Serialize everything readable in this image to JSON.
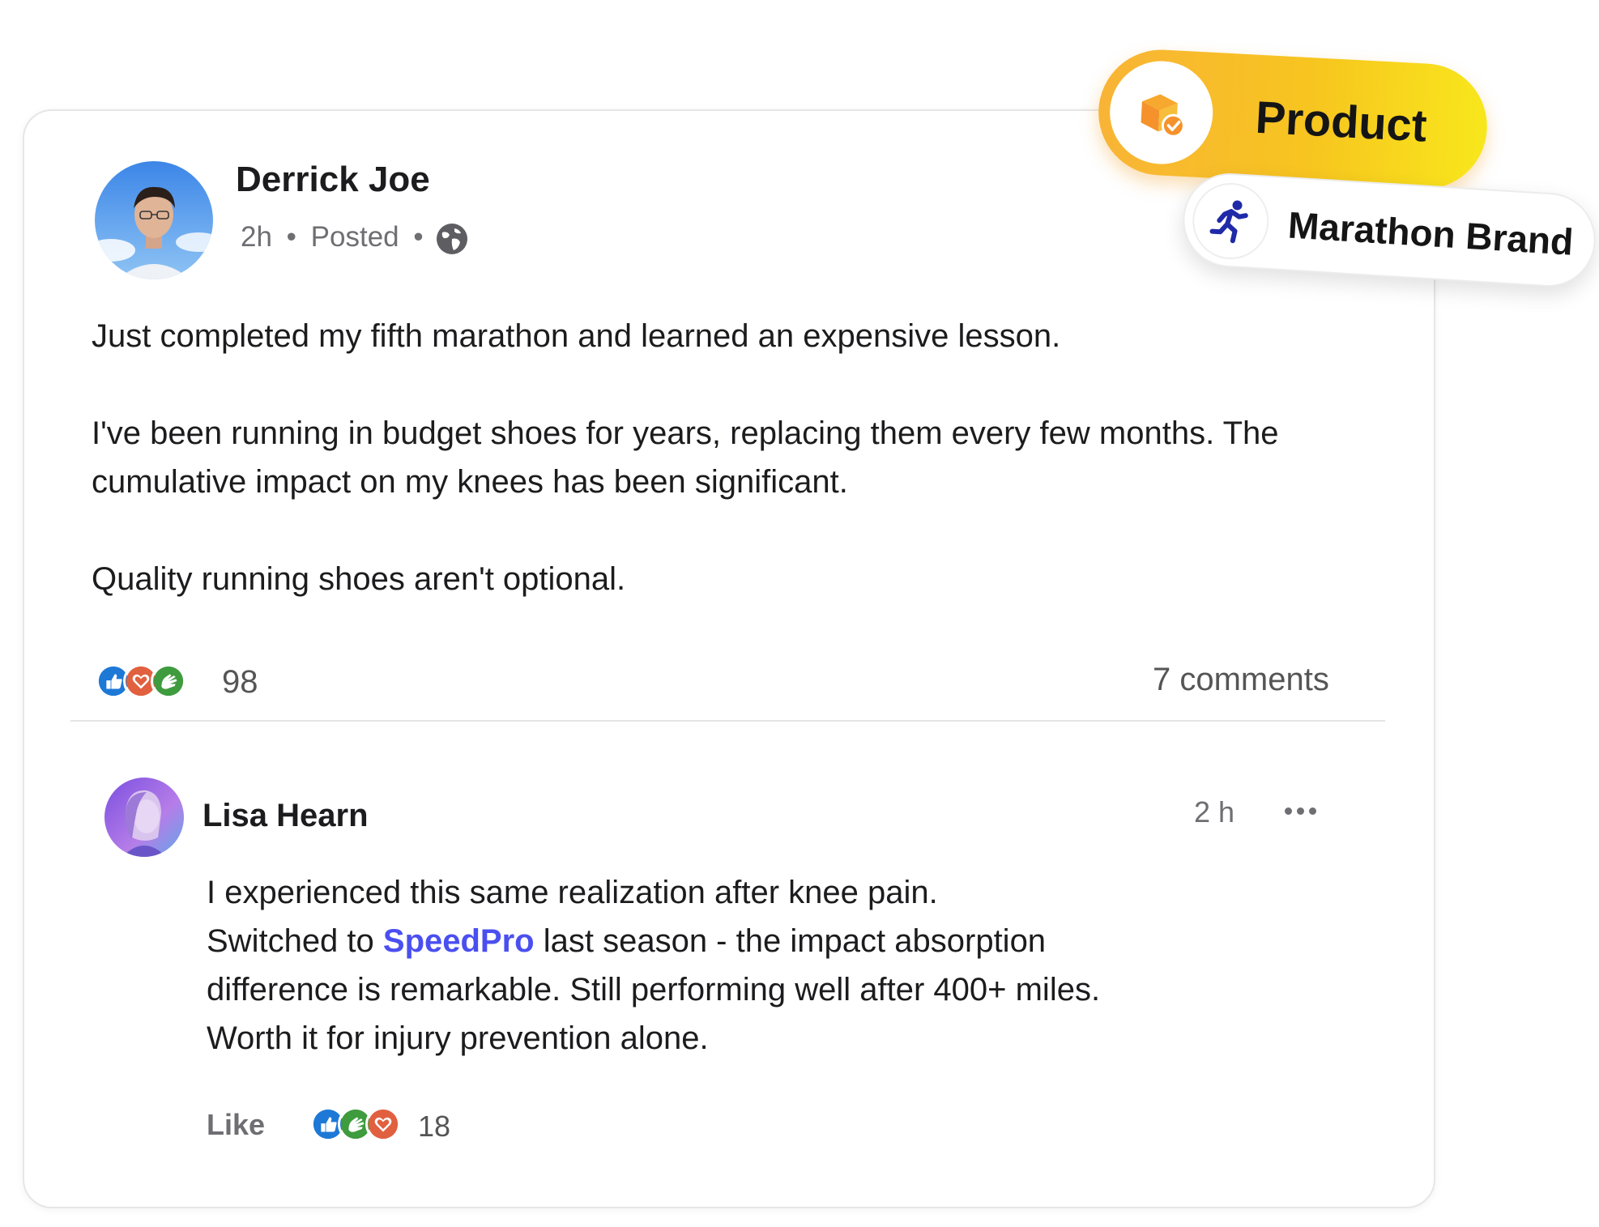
{
  "post": {
    "author_name": "Derrick Joe",
    "time": "2h",
    "status": "Posted",
    "separator": "•",
    "visibility_icon": "globe-icon",
    "paragraphs": [
      "Just completed my fifth marathon and learned an expensive lesson.",
      "I've been running in budget shoes for years, replacing them every few months. The",
      "cumulative impact on my knees has been significant.",
      "Quality running shoes aren't optional."
    ],
    "reaction_icons": [
      "like-icon",
      "love-icon",
      "celebrate-icon"
    ],
    "reaction_count": "98",
    "comments_label": "7 comments"
  },
  "comment": {
    "author_name": "Lisa Hearn",
    "time": "2 h",
    "lines": {
      "l1": "I experienced this same realization after knee pain.",
      "l2_before": "Switched to ",
      "mention": "SpeedPro",
      "l2_after": " last season - the impact absorption",
      "l3": "difference is remarkable. Still performing well after 400+ miles.",
      "l4": "Worth it for injury prevention alone."
    },
    "like_label": "Like",
    "reaction_icons": [
      "like-icon",
      "celebrate-icon",
      "love-icon"
    ],
    "reaction_count": "18"
  },
  "badges": {
    "product_label": "Product",
    "brand_label": "Marathon Brand"
  },
  "colors": {
    "mention": "#4a4ff0",
    "badge_gradient_start": "#f8b436",
    "badge_gradient_end": "#f8e71c",
    "brand_icon": "#1f2aa8",
    "like": "#1d78d6",
    "love": "#e1603f",
    "celebrate": "#3e9b3e"
  }
}
